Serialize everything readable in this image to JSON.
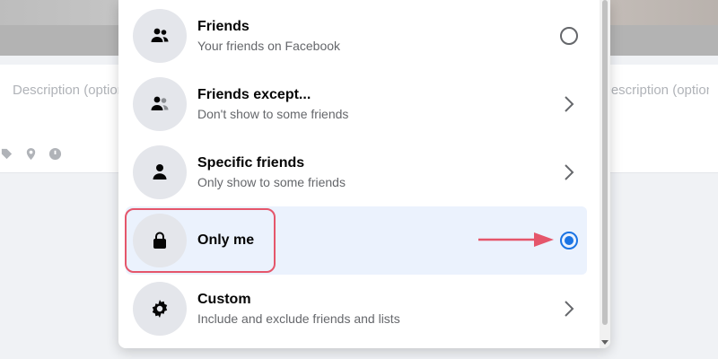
{
  "background": {
    "description_left": "Description (optional)",
    "description_right": "Description (optional)",
    "tools": [
      "tag-icon",
      "location-icon",
      "clock-icon"
    ]
  },
  "privacy_menu": {
    "options": [
      {
        "title": "Friends",
        "subtitle": "Your friends on Facebook",
        "icon": "friends-icon",
        "control": "radio",
        "selected": false
      },
      {
        "title": "Friends except...",
        "subtitle": "Don't show to some friends",
        "icon": "friends-except-icon",
        "control": "chevron",
        "selected": false
      },
      {
        "title": "Specific friends",
        "subtitle": "Only show to some friends",
        "icon": "person-icon",
        "control": "chevron",
        "selected": false
      },
      {
        "title": "Only me",
        "subtitle": "",
        "icon": "lock-icon",
        "control": "radio",
        "selected": true
      },
      {
        "title": "Custom",
        "subtitle": "Include and exclude friends and lists",
        "icon": "gear-icon",
        "control": "chevron",
        "selected": false
      }
    ]
  },
  "colors": {
    "accent": "#1b74e4",
    "selected_bg": "#ebf2fd",
    "annotation": "#e5566b"
  }
}
